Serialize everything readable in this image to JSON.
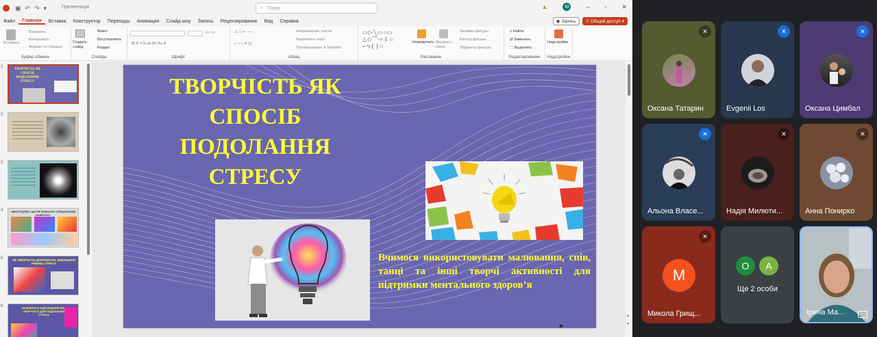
{
  "titlebar": {
    "doc_title": "Презентація",
    "search_placeholder": "Поиск"
  },
  "menu": {
    "items": [
      "Файл",
      "Главная",
      "Вставка",
      "Конструктор",
      "Переходы",
      "Анимация",
      "Слайд-шоу",
      "Запись",
      "Рецензирование",
      "Вид",
      "Справка"
    ],
    "record_label": "Запись",
    "share_label": "Общий доступ"
  },
  "ribbon": {
    "clipboard": {
      "paste": "Вставить",
      "cut": "Вырезать",
      "copy": "Копировать",
      "format": "Формат по образцу",
      "label": "Буфер обмена"
    },
    "slides": {
      "new_slide": "Создать слайд",
      "layout": "Макет",
      "reset": "Восстановить",
      "section": "Раздел",
      "label": "Слайды"
    },
    "font": {
      "label": "Шрифт"
    },
    "paragraph": {
      "dir": "Направление текста",
      "align": "Выровнять текст",
      "smartart": "Преобразовать в SmartArt",
      "label": "Абзац"
    },
    "drawing": {
      "arrange": "Упорядочить",
      "styles": "Экспресс-стили",
      "fill": "Заливка фигуры",
      "outline": "Контур фигуры",
      "effects": "Эффекты фигуры",
      "label": "Рисование"
    },
    "editing": {
      "find": "Найти",
      "replace": "Заменить",
      "select": "Выделить",
      "label": "Редактирование"
    },
    "addins": {
      "btn": "Надстройки",
      "label": "Надстройки"
    }
  },
  "thumbnails": [
    {
      "num": "1",
      "title": "ТВОРЧІСТЬ ЯК СПОСІБ ПОДОЛАННЯ СТРЕСУ"
    },
    {
      "num": "2",
      "title": ""
    },
    {
      "num": "3",
      "title": ""
    },
    {
      "num": "4",
      "title": "«МИСТЕЦТВО, ЩО НЕ ВИМАГАЄ СПЕЦІАЛЬНИХ НАВИЧОК»"
    },
    {
      "num": "5",
      "title": "ЯК ТВОРЧІСТЬ ДОПОМАГАЄ ЗМЕНШИТИ РІВЕНЬ СТРЕСУ"
    },
    {
      "num": "6",
      "title": "ЯК ВИБРАТИ ВІДПОВІДНИЙ ВИД ТВОРЧОСТІ ДЛЯ ПОДОЛАННЯ СТРЕСУ"
    }
  ],
  "slide": {
    "title_lines": [
      "ТВОРЧІСТЬ ЯК СПОСІБ",
      "ПОДОЛАННЯ",
      "СТРЕСУ"
    ],
    "body": "Вчимося використовувати малювання, спів, танці та інші творчі активності для підтримки ментального здоров’я"
  },
  "participants": [
    {
      "name": "Оксана Татарин",
      "bg": "#545b31",
      "mic": "blue"
    },
    {
      "name": "Evgenii Los",
      "bg": "#27384f",
      "mic": "blue"
    },
    {
      "name": "Оксана Цимбал",
      "bg": "#4d3a73",
      "mic": "blue"
    },
    {
      "name": "Альона Власе...",
      "bg": "#2a3d57",
      "mic": "blue"
    },
    {
      "name": "Надія Милюти...",
      "bg": "#4a1f1c",
      "mic": "dark"
    },
    {
      "name": "Анна Понирко",
      "bg": "#6e4a34",
      "mic": "dark"
    },
    {
      "name": "Микола Грищ...",
      "bg": "#8a2a1c",
      "mic": "dark",
      "initial": "M"
    },
    {
      "name": "Ще 2 особи",
      "bg": "#3c4043",
      "initials": [
        "O",
        "A"
      ]
    },
    {
      "name": "Ірина Ма...",
      "bg": "#9aa3a6"
    }
  ]
}
